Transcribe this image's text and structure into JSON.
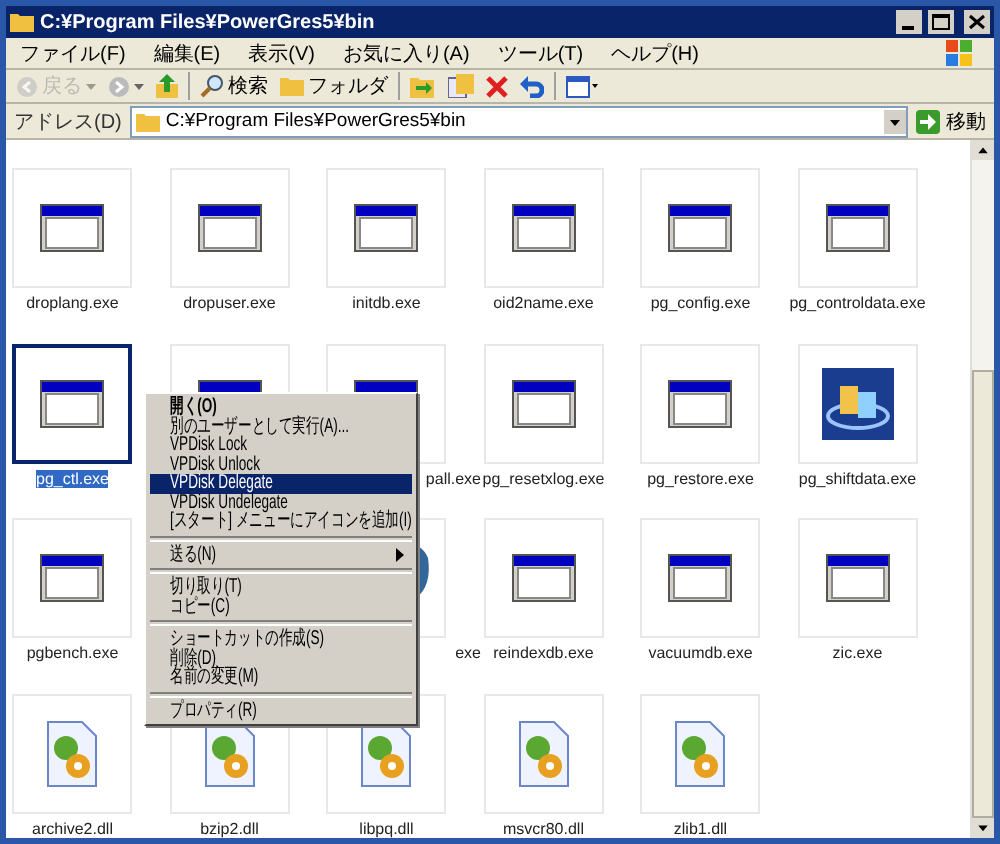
{
  "window": {
    "title": "C:¥Program Files¥PowerGres5¥bin"
  },
  "menu": [
    "ファイル(F)",
    "編集(E)",
    "表示(V)",
    "お気に入り(A)",
    "ツール(T)",
    "ヘルプ(H)"
  ],
  "toolbar": [
    {
      "kind": "back",
      "label": "戻る",
      "disabled": true
    },
    {
      "kind": "forward",
      "disabled": false
    },
    {
      "kind": "up",
      "disabled": false
    },
    {
      "kind": "search",
      "label": "検索",
      "disabled": false
    },
    {
      "kind": "folders",
      "label": "フォルダ",
      "disabled": false
    },
    {
      "kind": "move",
      "disabled": false
    },
    {
      "kind": "copy",
      "disabled": false
    },
    {
      "kind": "delete",
      "disabled": false
    },
    {
      "kind": "undo",
      "disabled": false
    },
    {
      "kind": "views",
      "disabled": false
    }
  ],
  "address": {
    "label": "アドレス(D)",
    "value": "C:¥Program Files¥PowerGres5¥bin",
    "go": "移動"
  },
  "files": [
    {
      "kind": "exe",
      "label": "droplang.exe",
      "selected": false
    },
    {
      "kind": "exe",
      "label": "dropuser.exe",
      "selected": false
    },
    {
      "kind": "exe",
      "label": "initdb.exe",
      "selected": false
    },
    {
      "kind": "exe",
      "label": "oid2name.exe",
      "selected": false
    },
    {
      "kind": "exe",
      "label": "pg_config.exe",
      "selected": false
    },
    {
      "kind": "exe",
      "label": "pg_controldata.exe",
      "selected": false
    },
    {
      "kind": "exe",
      "label": "pg_ctl.exe",
      "selected": true
    },
    {
      "kind": "exe",
      "selected": false
    },
    {
      "kind": "exe",
      "label": "pall.exe",
      "selected": false
    },
    {
      "kind": "exe",
      "label": "pg_resetxlog.exe",
      "selected": false
    },
    {
      "kind": "exe",
      "label": "pg_restore.exe",
      "selected": false
    },
    {
      "kind": "service",
      "label": "pg_shiftdata.exe",
      "selected": false
    },
    {
      "kind": "exe",
      "label": "pgbench.exe",
      "selected": false
    },
    {
      "kind": "hidden"
    },
    {
      "kind": "elephant",
      "label": "exe",
      "selected": false
    },
    {
      "kind": "exe",
      "label": "reindexdb.exe",
      "selected": false
    },
    {
      "kind": "exe",
      "label": "vacuumdb.exe",
      "selected": false
    },
    {
      "kind": "exe",
      "label": "zic.exe",
      "selected": false
    },
    {
      "kind": "dll",
      "label": "archive2.dll",
      "selected": false
    },
    {
      "kind": "dll",
      "label": "bzip2.dll",
      "selected": false
    },
    {
      "kind": "dll",
      "label": "libpq.dll",
      "selected": false
    },
    {
      "kind": "dll",
      "label": "msvcr80.dll",
      "selected": false
    },
    {
      "kind": "dll",
      "label": "zlib1.dll",
      "selected": false
    }
  ],
  "context_menu": [
    {
      "kind": "item",
      "label": "開く(O)",
      "bold": true,
      "selected": false
    },
    {
      "kind": "item",
      "label": "別のユーザーとして実行(A)...",
      "bold": false,
      "selected": false
    },
    {
      "kind": "item",
      "label": "VPDisk Lock",
      "bold": false,
      "selected": false
    },
    {
      "kind": "item",
      "label": "VPDisk Unlock",
      "bold": false,
      "selected": false
    },
    {
      "kind": "item",
      "label": "VPDisk Delegate",
      "bold": false,
      "selected": true
    },
    {
      "kind": "item",
      "label": "VPDisk Undelegate",
      "bold": false,
      "selected": false
    },
    {
      "kind": "item",
      "label": "[スタート] メニューにアイコンを追加(I)",
      "bold": false,
      "selected": false
    },
    {
      "kind": "separator"
    },
    {
      "kind": "submenu",
      "label": "送る(N)",
      "bold": false,
      "selected": false
    },
    {
      "kind": "separator"
    },
    {
      "kind": "item",
      "label": "切り取り(T)",
      "bold": false,
      "selected": false
    },
    {
      "kind": "item",
      "label": "コピー(C)",
      "bold": false,
      "selected": false
    },
    {
      "kind": "separator"
    },
    {
      "kind": "item",
      "label": "ショートカットの作成(S)",
      "bold": false,
      "selected": false
    },
    {
      "kind": "item",
      "label": "削除(D)",
      "bold": false,
      "selected": false
    },
    {
      "kind": "item",
      "label": "名前の変更(M)",
      "bold": false,
      "selected": false
    },
    {
      "kind": "separator"
    },
    {
      "kind": "item",
      "label": "プロパティ(R)",
      "bold": false,
      "selected": false
    }
  ]
}
